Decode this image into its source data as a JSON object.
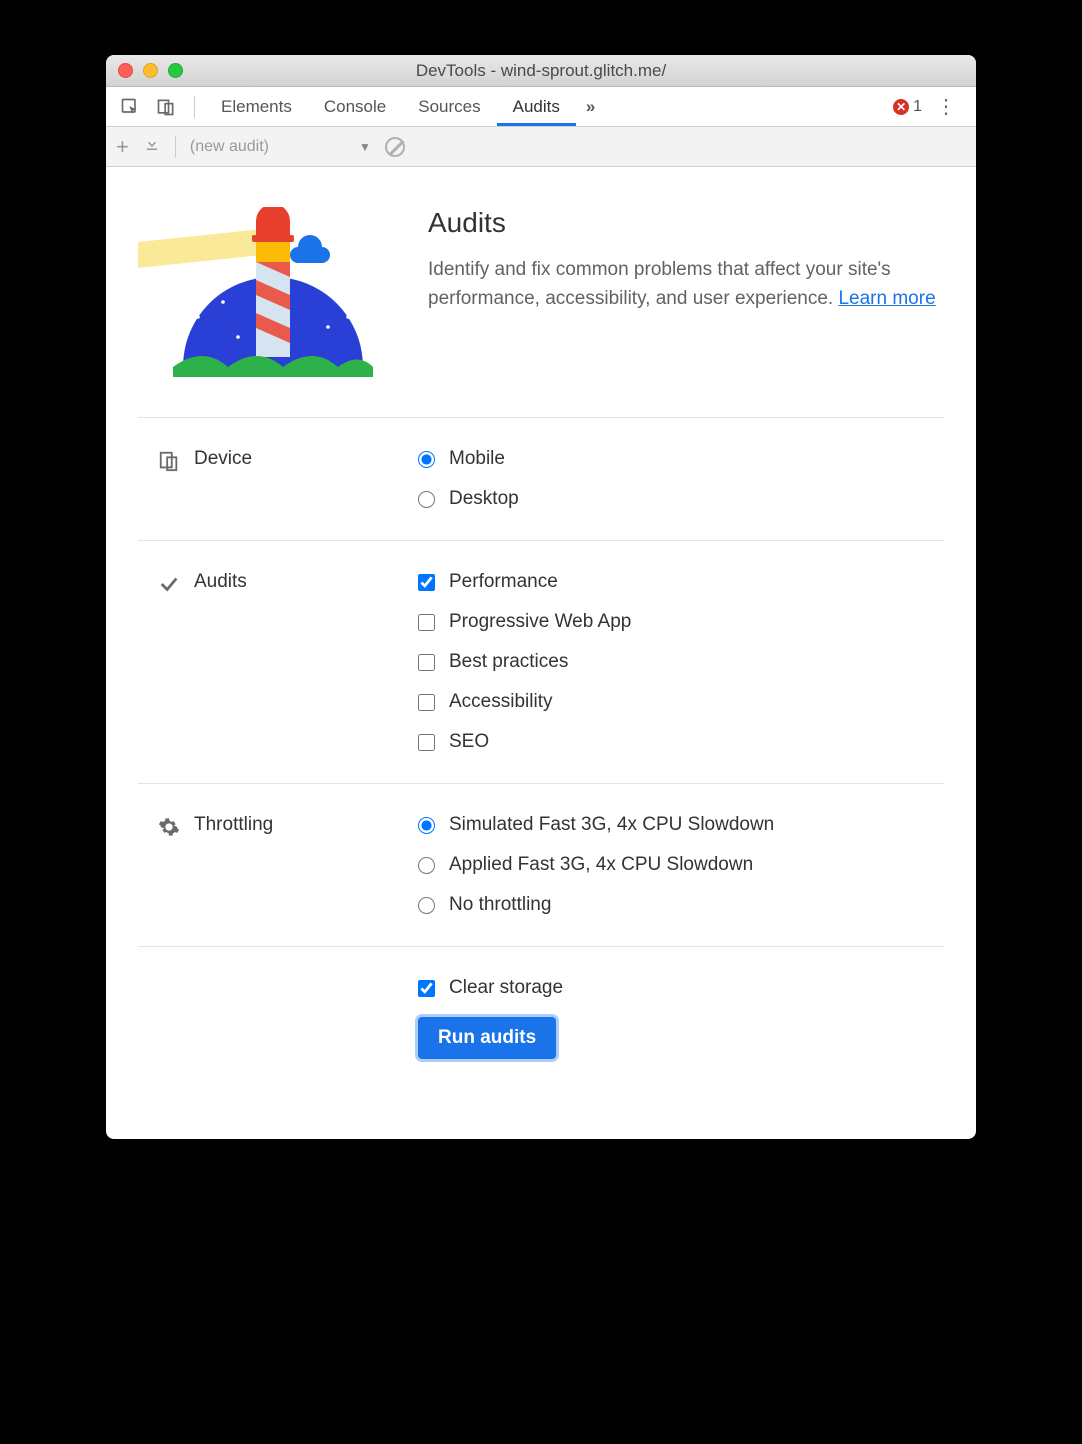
{
  "window": {
    "title": "DevTools - wind-sprout.glitch.me/"
  },
  "tabs": {
    "items": [
      "Elements",
      "Console",
      "Sources",
      "Audits"
    ],
    "active": "Audits",
    "error_count": "1"
  },
  "subbar": {
    "audit_name": "(new audit)"
  },
  "hero": {
    "title": "Audits",
    "desc_prefix": "Identify and fix common problems that affect your site's performance, accessibility, and user experience. ",
    "learn_more": "Learn more"
  },
  "device": {
    "label": "Device",
    "options": [
      {
        "label": "Mobile",
        "checked": true
      },
      {
        "label": "Desktop",
        "checked": false
      }
    ]
  },
  "audits": {
    "label": "Audits",
    "options": [
      {
        "label": "Performance",
        "checked": true
      },
      {
        "label": "Progressive Web App",
        "checked": false
      },
      {
        "label": "Best practices",
        "checked": false
      },
      {
        "label": "Accessibility",
        "checked": false
      },
      {
        "label": "SEO",
        "checked": false
      }
    ]
  },
  "throttling": {
    "label": "Throttling",
    "options": [
      {
        "label": "Simulated Fast 3G, 4x CPU Slowdown",
        "checked": true
      },
      {
        "label": "Applied Fast 3G, 4x CPU Slowdown",
        "checked": false
      },
      {
        "label": "No throttling",
        "checked": false
      }
    ]
  },
  "clear_storage": {
    "label": "Clear storage",
    "checked": true
  },
  "run_button": "Run audits"
}
